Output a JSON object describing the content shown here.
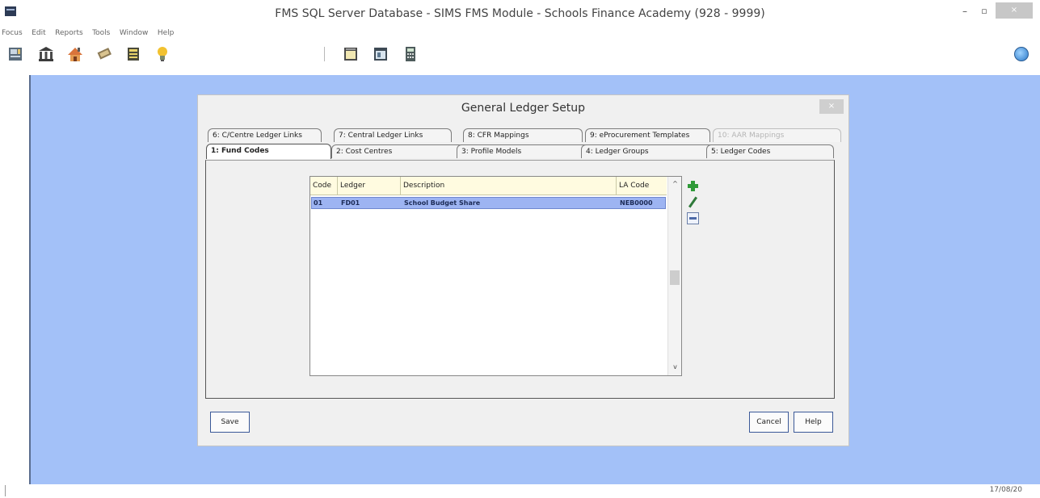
{
  "window": {
    "title": "FMS SQL Server Database - SIMS FMS Module - Schools Finance Academy (928 - 9999)",
    "minimize": "–",
    "maximize": "▫",
    "close": "×"
  },
  "menu": [
    "Focus",
    "Edit",
    "Reports",
    "Tools",
    "Window",
    "Help"
  ],
  "toolbar": {
    "icons": [
      "ledger-icon",
      "bank-icon",
      "house-icon",
      "payment-icon",
      "calculator-list-icon",
      "lightbulb-icon",
      "calendar-icon",
      "period-icon",
      "calculator-icon",
      "help-globe-icon"
    ]
  },
  "dialog": {
    "title": "General Ledger Setup",
    "close": "×",
    "tabs_back": [
      {
        "label": "6: C/Centre Ledger Links",
        "disabled": false
      },
      {
        "label": "7: Central Ledger Links",
        "disabled": false
      },
      {
        "label": "8: CFR Mappings",
        "disabled": false
      },
      {
        "label": "9: eProcurement Templates",
        "disabled": false
      },
      {
        "label": "10: AAR Mappings",
        "disabled": true
      }
    ],
    "tabs_front": [
      {
        "label": "1: Fund Codes",
        "active": true
      },
      {
        "label": "2: Cost Centres",
        "active": false
      },
      {
        "label": "3: Profile Models",
        "active": false
      },
      {
        "label": "4: Ledger Groups",
        "active": false
      },
      {
        "label": "5: Ledger Codes",
        "active": false
      }
    ],
    "grid": {
      "columns": [
        "Code",
        "Ledger",
        "Description",
        "LA Code"
      ],
      "rows": [
        {
          "code": "01",
          "ledger": "FD01",
          "description": "School Budget Share",
          "la_code": "NEB0000"
        }
      ],
      "scroll_up": "^",
      "scroll_down": "v"
    },
    "buttons": {
      "save": "Save",
      "cancel": "Cancel",
      "help": "Help"
    }
  },
  "status": {
    "date": "17/08/20"
  },
  "colors": {
    "workspace": "#a3c1f8",
    "selected_row": "#9db4f2",
    "grid_header": "#fffbe0"
  }
}
